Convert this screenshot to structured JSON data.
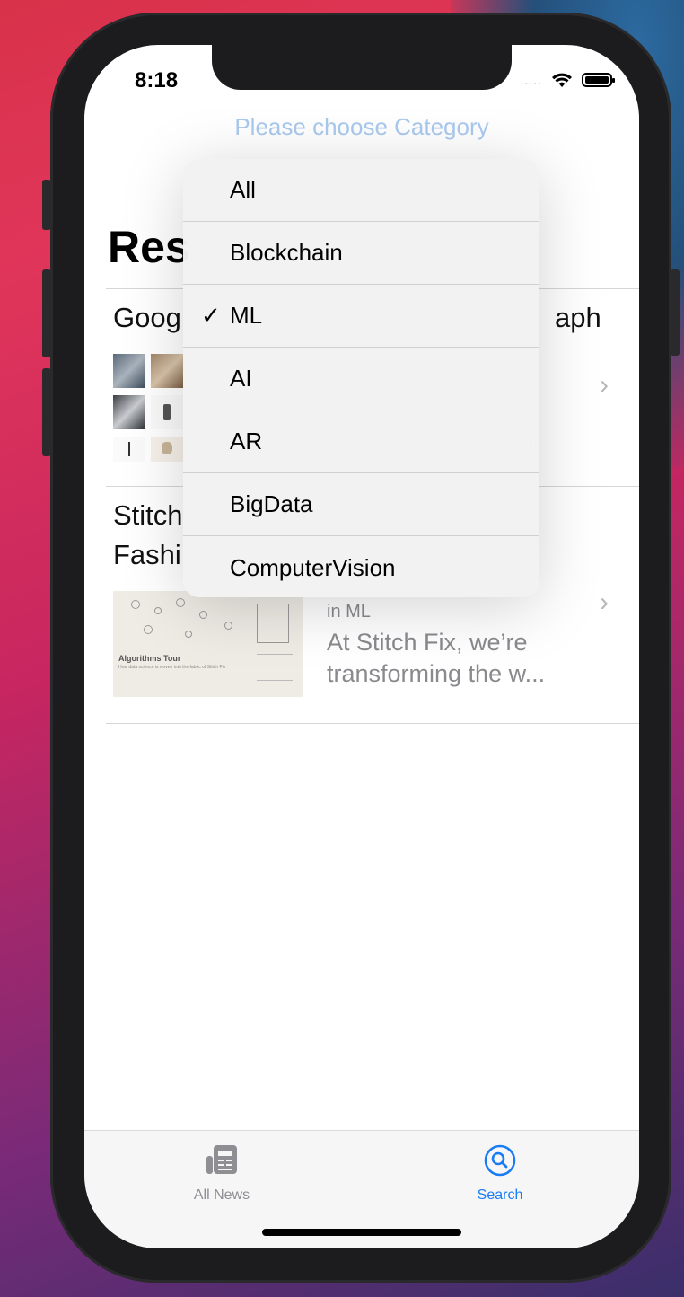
{
  "status": {
    "time": "8:18",
    "signal": "....."
  },
  "header": {
    "choose_category": "Please choose Category"
  },
  "main": {
    "results_heading": "Res",
    "articles": [
      {
        "title_left": "Goog",
        "title_right": "aph",
        "ellipsis": ".."
      },
      {
        "title_line1": "Stitch",
        "title_line2": "Fashi",
        "category": "in ML",
        "description_line1": "At Stitch Fix, we’re",
        "description_line2": "transforming the w...",
        "thumb_caption": "Algorithms Tour",
        "thumb_subcaption": "How data science is woven into the fabric of Stitch Fix"
      }
    ]
  },
  "category_menu": {
    "selected": "ML",
    "items": [
      {
        "label": "All",
        "checked": ""
      },
      {
        "label": "Blockchain",
        "checked": ""
      },
      {
        "label": "ML",
        "checked": "✓"
      },
      {
        "label": "AI",
        "checked": ""
      },
      {
        "label": "AR",
        "checked": ""
      },
      {
        "label": "BigData",
        "checked": ""
      },
      {
        "label": "ComputerVision",
        "checked": ""
      }
    ]
  },
  "tabbar": {
    "tabs": [
      {
        "label": "All News",
        "icon": "newspaper-icon",
        "active": false
      },
      {
        "label": "Search",
        "icon": "search-icon",
        "active": true
      }
    ],
    "active_color": "#1a7cf5",
    "inactive_color": "#8e8e93"
  },
  "colors": {
    "placeholder_blue": "#a9c9ee",
    "secondary_text": "#8a8a8e"
  }
}
